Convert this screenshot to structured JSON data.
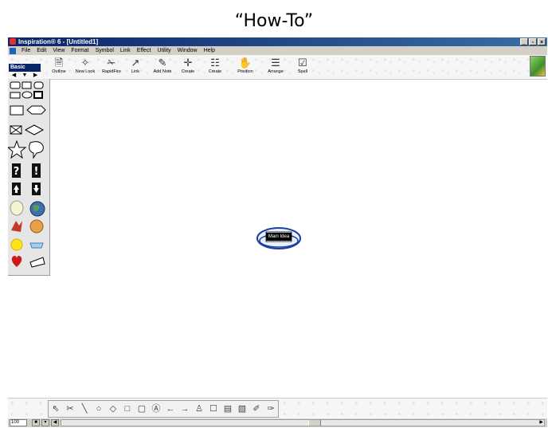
{
  "slide": {
    "title": "“How-To”"
  },
  "window": {
    "title": "Inspiration® 6 - [Untitled1]",
    "controls": [
      "_",
      "▫",
      "×"
    ]
  },
  "menu": [
    "File",
    "Edit",
    "View",
    "Format",
    "Symbol",
    "Link",
    "Effect",
    "Utility",
    "Window",
    "Help"
  ],
  "palette": {
    "label": "Basic",
    "nav": [
      "◀",
      "▼",
      "▶"
    ]
  },
  "toolbar": {
    "tools": [
      {
        "name": "outline",
        "label": "Outline",
        "glyph": "🗎"
      },
      {
        "name": "new-look",
        "label": "New Look",
        "glyph": "✧"
      },
      {
        "name": "rapidfire",
        "label": "RapidFire",
        "glyph": "✁"
      },
      {
        "name": "link",
        "label": "Link",
        "glyph": "↗"
      },
      {
        "name": "add-note",
        "label": "Add Note",
        "glyph": "✎"
      },
      {
        "name": "create-1",
        "label": "Create",
        "glyph": "✛"
      },
      {
        "name": "create-2",
        "label": "Create",
        "glyph": "☷"
      },
      {
        "name": "position",
        "label": "Position",
        "glyph": "✋"
      },
      {
        "name": "arrange",
        "label": "Arrange",
        "glyph": "☰"
      },
      {
        "name": "spell",
        "label": "Spell",
        "glyph": "☑"
      }
    ]
  },
  "canvas": {
    "main_idea": "Main Idea"
  },
  "drawing_tools": [
    "⇖",
    "✂",
    "╲",
    "○",
    "◇",
    "□",
    "▢",
    "Ⓐ",
    "←",
    "→",
    "♙",
    "☐",
    "▤",
    "▧",
    "✐",
    "✑"
  ],
  "status": {
    "zoom": "100"
  }
}
